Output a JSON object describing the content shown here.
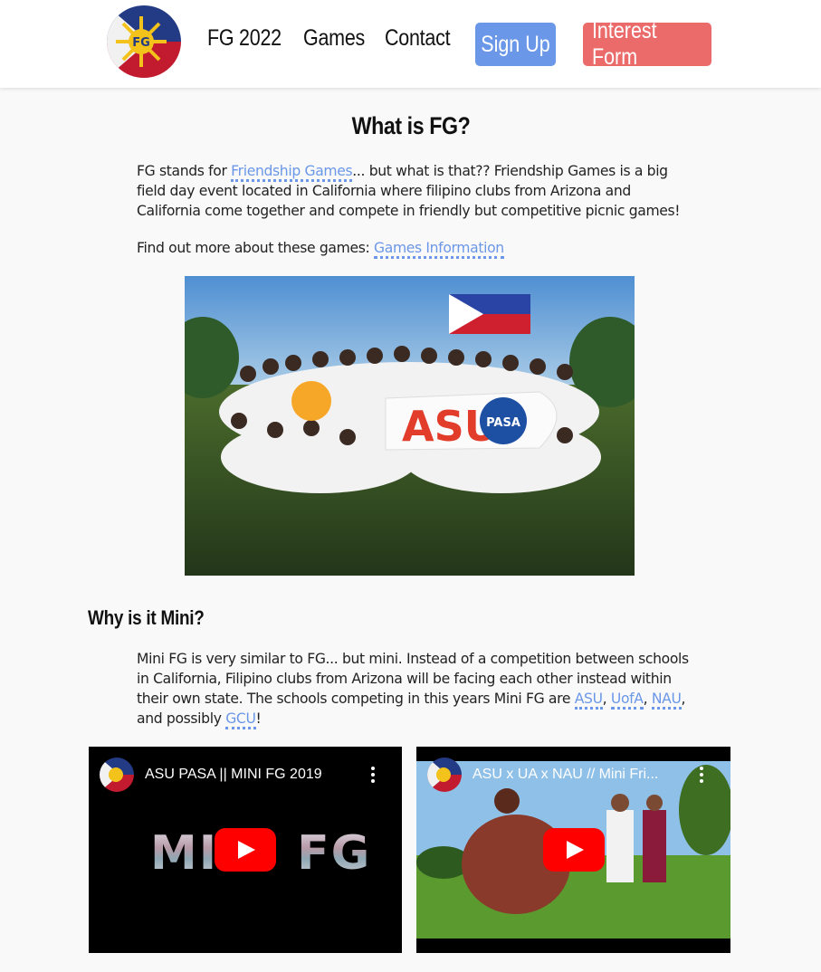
{
  "nav": {
    "links": [
      "FG 2022",
      "Games",
      "Contact"
    ],
    "signup_label": "Sign Up",
    "interest_label": "Interest Form",
    "colors": {
      "signup": "#6b97e8",
      "interest": "#eb6b6b"
    }
  },
  "section1": {
    "heading": "What is FG?",
    "p1_before": "FG stands for ",
    "p1_link": "Friendship Games",
    "p1_after": "... but what is that?? Friendship Games is a big field day event located in California where filipino clubs from Arizona and California come together and compete in friendly but competitive picnic games!",
    "p2_before": "Find out more about these games: ",
    "p2_link": "Games Information",
    "photo_banner_text": "ASU",
    "photo_logo_text": "PASA"
  },
  "section2": {
    "heading": "Why is it Mini?",
    "p3_text": "Mini FG is very similar to FG... but mini. Instead of a competition between schools in California, Filipino clubs from Arizona will be facing each other instead within their own state. The schools competing in this years Mini FG are ",
    "school_links": [
      "ASU",
      "UofA",
      "NAU"
    ],
    "p3_and": ", and possibly ",
    "p3_last_link": "GCU",
    "p3_end": "!"
  },
  "videos": [
    {
      "title": "ASU PASA || MINI FG 2019",
      "thumb_text": "MINI FG"
    },
    {
      "title": "ASU x UA x NAU // Mini Fri..."
    }
  ],
  "link_color": "#6b97e8"
}
